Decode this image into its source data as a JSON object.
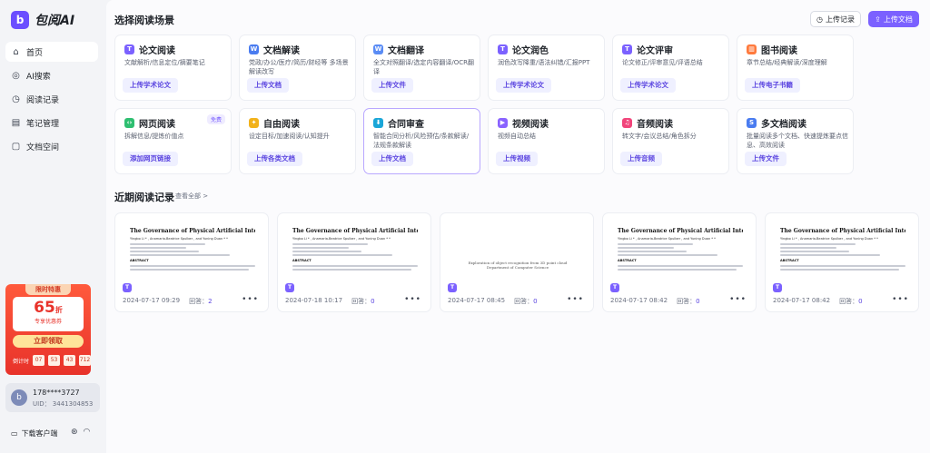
{
  "brand": {
    "mark": "b",
    "name": "包阅AI"
  },
  "nav": [
    {
      "label": "首页",
      "icon": "⌂",
      "icon_name": "home-icon",
      "active": true
    },
    {
      "label": "AI搜索",
      "icon": "◎",
      "icon_name": "search-icon",
      "active": false
    },
    {
      "label": "阅读记录",
      "icon": "◷",
      "icon_name": "clock-icon",
      "active": false
    },
    {
      "label": "笔记管理",
      "icon": "▤",
      "icon_name": "note-icon",
      "active": false
    },
    {
      "label": "文档空间",
      "icon": "▢",
      "icon_name": "folder-icon",
      "active": false
    }
  ],
  "promo": {
    "tag": "限时特惠",
    "discount": "65",
    "unit": "折",
    "subtitle": "专享优惠券",
    "button": "立即领取",
    "countdown_label": "倒计时",
    "countdown": [
      "07",
      "53",
      "43",
      "712"
    ]
  },
  "user": {
    "avatar": "b",
    "phone": "178****3727",
    "uid": "UID： 3441304853"
  },
  "footer": {
    "download": "下载客户端"
  },
  "header": {
    "title": "选择阅读场景",
    "record_btn": "上传记录",
    "upload_btn": "上传文档"
  },
  "scenes": [
    {
      "title": "论文阅读",
      "desc": "文献解析/信息定位/摘要笔记",
      "btn": "上传学术论文",
      "icon": "T",
      "color": "#7b61ff"
    },
    {
      "title": "文档解读",
      "desc": "党政/办公/医疗/简历/财经等 多场景解读改写",
      "btn": "上传文档",
      "icon": "W",
      "color": "#4a7cf0"
    },
    {
      "title": "文档翻译",
      "desc": "全文对照翻译/选定内容翻译/OCR翻译",
      "btn": "上传文件",
      "icon": "W",
      "color": "#5a8cf5"
    },
    {
      "title": "论文润色",
      "desc": "润色改写降重/语法纠错/汇报PPT",
      "btn": "上传学术论文",
      "icon": "T",
      "color": "#7b61ff"
    },
    {
      "title": "论文评审",
      "desc": "论文修正/评审意见/评语总结",
      "btn": "上传学术论文",
      "icon": "T",
      "color": "#7b61ff"
    },
    {
      "title": "图书阅读",
      "desc": "章节总结/经典解读/深度理解",
      "btn": "上传电子书籍",
      "icon": "▥",
      "color": "#ff7a3d"
    },
    {
      "title": "网页阅读",
      "desc": "拆解信息/提炼价值点",
      "btn": "添加网页链接",
      "icon": "‹›",
      "color": "#2fbf71",
      "badge": "免费"
    },
    {
      "title": "自由阅读",
      "desc": "设定目标/加速阅读/认知提升",
      "btn": "上传各类文档",
      "icon": "✦",
      "color": "#f2b21b"
    },
    {
      "title": "合同审查",
      "desc": "智能合同分析/风险预估/条款解读/法规条款解读",
      "btn": "上传文档",
      "icon": "⬇",
      "color": "#1aa6d8",
      "highlight": true
    },
    {
      "title": "视频阅读",
      "desc": "视频自动总结",
      "btn": "上传视频",
      "icon": "▶",
      "color": "#8a63ff"
    },
    {
      "title": "音频阅读",
      "desc": "转文字/会议总结/角色拆分",
      "btn": "上传音频",
      "icon": "♫",
      "color": "#f1457b"
    },
    {
      "title": "多文档阅读",
      "desc": "批量阅读多个文档、快速提炼要点信息、高效阅读",
      "btn": "上传文件",
      "icon": "S",
      "color": "#4a7cf0"
    }
  ],
  "recent": {
    "title": "近期阅读记录",
    "more": "查看全部 >",
    "answer_label": "回答：",
    "docs": [
      {
        "type": "paper",
        "title": "The Governance of Physical Artificial Intelligence",
        "authors": "Yingbo Li * , Anamaria-Beatrice Spulber , and Yuning Duan * *",
        "section": "ABSTRACT",
        "date": "2024-07-17 09:29",
        "answers": "2"
      },
      {
        "type": "paper",
        "title": "The Governance of Physical Artificial Intelligence",
        "authors": "Yingbo Li * , Anamaria-Beatrice Spulber , and Yuning Duan * *",
        "section": "ABSTRACT",
        "date": "2024-07-18 10:17",
        "answers": "0"
      },
      {
        "type": "plain",
        "title": "Exploration of object recognition from 3D point cloud",
        "authors": "Department of Computer Science",
        "section": "",
        "date": "2024-07-17 08:45",
        "answers": "0"
      },
      {
        "type": "paper",
        "title": "The Governance of Physical Artificial Intelligence",
        "authors": "Yingbo Li * , Anamaria-Beatrice Spulber , and Yuning Duan * *",
        "section": "ABSTRACT",
        "date": "2024-07-17 08:42",
        "answers": "0"
      },
      {
        "type": "paper",
        "title": "The Governance of Physical Artificial Intelligence",
        "authors": "Yingbo Li * , Anamaria-Beatrice Spulber , and Yuning Duan * *",
        "section": "ABSTRACT",
        "date": "2024-07-17 08:42",
        "answers": "0"
      }
    ]
  }
}
